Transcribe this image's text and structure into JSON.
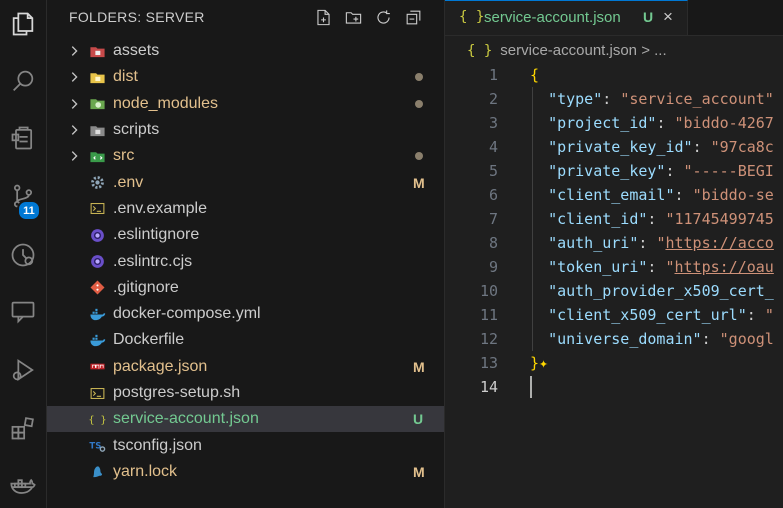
{
  "activity_bar": {
    "items": [
      {
        "icon": "files-icon"
      },
      {
        "icon": "search-icon"
      },
      {
        "icon": "clipboard-icon"
      },
      {
        "icon": "source-control-icon"
      },
      {
        "icon": "git-history-icon"
      },
      {
        "icon": "comments-icon"
      },
      {
        "icon": "run-debug-icon"
      },
      {
        "icon": "extensions-icon"
      },
      {
        "icon": "docker-icon"
      }
    ],
    "source_control_badge": "11"
  },
  "explorer": {
    "title": "FOLDERS: SERVER",
    "actions": [
      "new-file-icon",
      "new-folder-icon",
      "refresh-icon",
      "collapse-all-icon"
    ],
    "items": [
      {
        "label": "assets",
        "type": "folder",
        "icon": "folder-assets-icon",
        "status": "",
        "dot": false,
        "color": "#cccccc"
      },
      {
        "label": "dist",
        "type": "folder",
        "icon": "folder-dist-icon",
        "status": "",
        "dot": true,
        "color": "#e2c08d"
      },
      {
        "label": "node_modules",
        "type": "folder",
        "icon": "folder-node-icon",
        "status": "",
        "dot": true,
        "color": "#e2c08d"
      },
      {
        "label": "scripts",
        "type": "folder",
        "icon": "folder-scripts-icon",
        "status": "",
        "dot": false,
        "color": "#cccccc"
      },
      {
        "label": "src",
        "type": "folder",
        "icon": "folder-src-icon",
        "status": "",
        "dot": true,
        "color": "#e2c08d"
      },
      {
        "label": ".env",
        "type": "file",
        "icon": "gear-icon",
        "status": "M",
        "dot": false,
        "color": "#e2c08d"
      },
      {
        "label": ".env.example",
        "type": "file",
        "icon": "terminal-icon",
        "status": "",
        "dot": false,
        "color": "#cccccc"
      },
      {
        "label": ".eslintignore",
        "type": "file",
        "icon": "eslint-icon",
        "status": "",
        "dot": false,
        "color": "#cccccc"
      },
      {
        "label": ".eslintrc.cjs",
        "type": "file",
        "icon": "eslint-icon",
        "status": "",
        "dot": false,
        "color": "#cccccc"
      },
      {
        "label": ".gitignore",
        "type": "file",
        "icon": "git-icon",
        "status": "",
        "dot": false,
        "color": "#cccccc"
      },
      {
        "label": "docker-compose.yml",
        "type": "file",
        "icon": "docker-whale-icon",
        "status": "",
        "dot": false,
        "color": "#cccccc"
      },
      {
        "label": "Dockerfile",
        "type": "file",
        "icon": "docker-whale-icon",
        "status": "",
        "dot": false,
        "color": "#cccccc"
      },
      {
        "label": "package.json",
        "type": "file",
        "icon": "npm-icon",
        "status": "M",
        "dot": false,
        "color": "#e2c08d"
      },
      {
        "label": "postgres-setup.sh",
        "type": "file",
        "icon": "terminal-icon",
        "status": "",
        "dot": false,
        "color": "#cccccc"
      },
      {
        "label": "service-account.json",
        "type": "file",
        "icon": "json-braces-icon",
        "status": "U",
        "dot": false,
        "color": "#73c991",
        "selected": true
      },
      {
        "label": "tsconfig.json",
        "type": "file",
        "icon": "typescript-config-icon",
        "status": "",
        "dot": false,
        "color": "#cccccc"
      },
      {
        "label": "yarn.lock",
        "type": "file",
        "icon": "yarn-icon",
        "status": "M",
        "dot": false,
        "color": "#e2c08d"
      }
    ]
  },
  "editor": {
    "tab": {
      "icon_text": "{ }",
      "name": "service-account.json",
      "status": "U",
      "close": "×"
    },
    "breadcrumb": {
      "icon_text": "{ }",
      "file": "service-account.json",
      "sep": ">",
      "more": "..."
    },
    "lines": [
      {
        "n": "1",
        "segs": [
          {
            "t": "{",
            "c": "b"
          }
        ]
      },
      {
        "n": "2",
        "segs": [
          {
            "t": "  ",
            "c": "p"
          },
          {
            "t": "\"type\"",
            "c": "k"
          },
          {
            "t": ": ",
            "c": "p"
          },
          {
            "t": "\"service_account\"",
            "c": "s"
          }
        ]
      },
      {
        "n": "3",
        "segs": [
          {
            "t": "  ",
            "c": "p"
          },
          {
            "t": "\"project_id\"",
            "c": "k"
          },
          {
            "t": ": ",
            "c": "p"
          },
          {
            "t": "\"biddo-4267",
            "c": "s"
          }
        ]
      },
      {
        "n": "4",
        "segs": [
          {
            "t": "  ",
            "c": "p"
          },
          {
            "t": "\"private_key_id\"",
            "c": "k"
          },
          {
            "t": ": ",
            "c": "p"
          },
          {
            "t": "\"97ca8c",
            "c": "s"
          }
        ]
      },
      {
        "n": "5",
        "segs": [
          {
            "t": "  ",
            "c": "p"
          },
          {
            "t": "\"private_key\"",
            "c": "k"
          },
          {
            "t": ": ",
            "c": "p"
          },
          {
            "t": "\"-----BEGI",
            "c": "s"
          }
        ]
      },
      {
        "n": "6",
        "segs": [
          {
            "t": "  ",
            "c": "p"
          },
          {
            "t": "\"client_email\"",
            "c": "k"
          },
          {
            "t": ": ",
            "c": "p"
          },
          {
            "t": "\"biddo-se",
            "c": "s"
          }
        ]
      },
      {
        "n": "7",
        "segs": [
          {
            "t": "  ",
            "c": "p"
          },
          {
            "t": "\"client_id\"",
            "c": "k"
          },
          {
            "t": ": ",
            "c": "p"
          },
          {
            "t": "\"11745499745",
            "c": "s"
          }
        ]
      },
      {
        "n": "8",
        "segs": [
          {
            "t": "  ",
            "c": "p"
          },
          {
            "t": "\"auth_uri\"",
            "c": "k"
          },
          {
            "t": ": ",
            "c": "p"
          },
          {
            "t": "\"",
            "c": "s"
          },
          {
            "t": "https://acco",
            "c": "u"
          }
        ]
      },
      {
        "n": "9",
        "segs": [
          {
            "t": "  ",
            "c": "p"
          },
          {
            "t": "\"token_uri\"",
            "c": "k"
          },
          {
            "t": ": ",
            "c": "p"
          },
          {
            "t": "\"",
            "c": "s"
          },
          {
            "t": "https://oau",
            "c": "u"
          }
        ]
      },
      {
        "n": "10",
        "segs": [
          {
            "t": "  ",
            "c": "p"
          },
          {
            "t": "\"auth_provider_x509_cert_",
            "c": "k"
          }
        ]
      },
      {
        "n": "11",
        "segs": [
          {
            "t": "  ",
            "c": "p"
          },
          {
            "t": "\"client_x509_cert_url\"",
            "c": "k"
          },
          {
            "t": ": ",
            "c": "p"
          },
          {
            "t": "\"",
            "c": "s"
          }
        ]
      },
      {
        "n": "12",
        "segs": [
          {
            "t": "  ",
            "c": "p"
          },
          {
            "t": "\"universe_domain\"",
            "c": "k"
          },
          {
            "t": ": ",
            "c": "p"
          },
          {
            "t": "\"googl",
            "c": "s"
          }
        ]
      },
      {
        "n": "13",
        "segs": [
          {
            "t": "}",
            "c": "b"
          },
          {
            "t": "✦",
            "c": "b"
          }
        ]
      },
      {
        "n": "14",
        "segs": [],
        "active": true
      }
    ]
  },
  "colors": {
    "accent": "#0078d4",
    "modified": "#e2c08d",
    "untracked": "#73c991",
    "json_key": "#9cdcfe",
    "json_string": "#ce9178"
  }
}
